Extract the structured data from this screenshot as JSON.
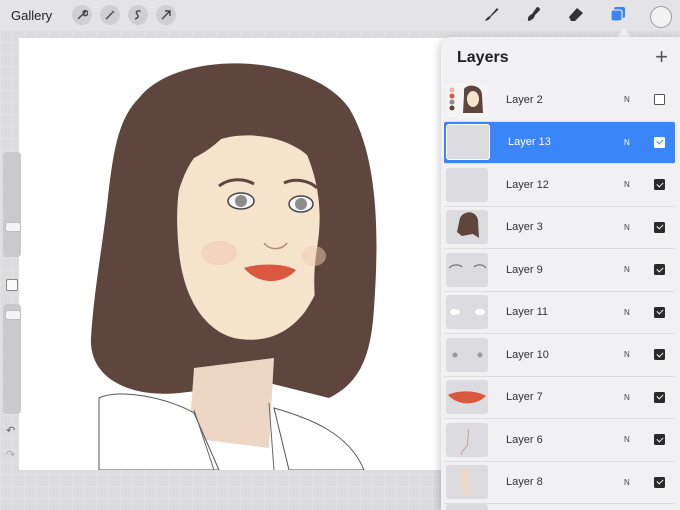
{
  "topbar": {
    "gallery_label": "Gallery",
    "left_tools": [
      "wrench-icon",
      "magic-wand-icon",
      "selection-icon",
      "transform-arrow-icon"
    ],
    "right_tools": [
      "brush-icon",
      "smudge-icon",
      "eraser-icon",
      "layers-icon",
      "color-picker-icon"
    ],
    "accent_color": "#3a86f8"
  },
  "layers_panel": {
    "title": "Layers",
    "add_button": "+",
    "layers": [
      {
        "name": "Layer 2",
        "blend": "N",
        "visible": false,
        "selected": false
      },
      {
        "name": "Layer 13",
        "blend": "N",
        "visible": true,
        "selected": true
      },
      {
        "name": "Layer 12",
        "blend": "N",
        "visible": true,
        "selected": false
      },
      {
        "name": "Layer 3",
        "blend": "N",
        "visible": true,
        "selected": false
      },
      {
        "name": "Layer 9",
        "blend": "N",
        "visible": true,
        "selected": false
      },
      {
        "name": "Layer 11",
        "blend": "N",
        "visible": true,
        "selected": false
      },
      {
        "name": "Layer 10",
        "blend": "N",
        "visible": true,
        "selected": false
      },
      {
        "name": "Layer 7",
        "blend": "N",
        "visible": true,
        "selected": false
      },
      {
        "name": "Layer 6",
        "blend": "N",
        "visible": true,
        "selected": false
      },
      {
        "name": "Layer 8",
        "blend": "N",
        "visible": true,
        "selected": false
      }
    ]
  },
  "sidebar": {
    "undo_icon": "undo-icon",
    "redo_icon": "redo-icon"
  }
}
